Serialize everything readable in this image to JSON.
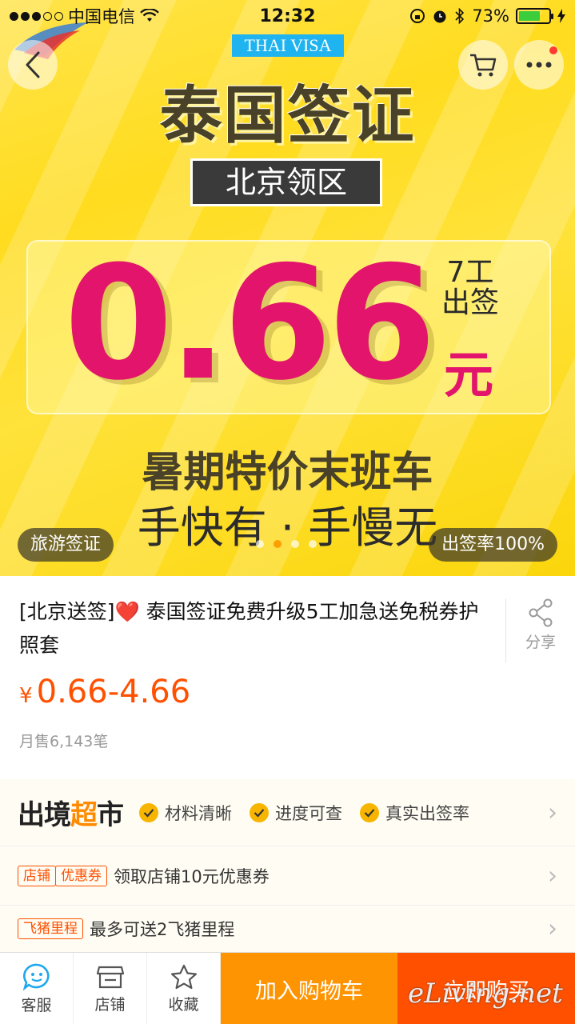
{
  "status_bar": {
    "carrier": "中国电信",
    "time": "12:32",
    "battery": "73%",
    "battery_level": 0.73
  },
  "hero": {
    "visa_tag": "THAI VISA",
    "title": "泰国签证",
    "region": "北京领区",
    "price": "0.66",
    "badge_line1": "7工",
    "badge_line2": "出签",
    "badge_unit": "元",
    "slogan_1": "暑期特价末班车",
    "slogan_2": "手快有 · 手慢无",
    "pill_left": "旅游签证",
    "pill_right": "出签率100%",
    "carousel_active_index": 1
  },
  "product": {
    "title_prefix": "[北京送签]",
    "title_heart": "❤️",
    "title_main": "泰国签证免费升级5工加急送免税券护照套",
    "share_label": "分享",
    "currency": "¥",
    "price_range": "0.66-4.66",
    "monthly_sales": "月售6,143笔"
  },
  "promo": {
    "brand_prefix": "出境",
    "brand_mid": "超",
    "brand_suffix": "市",
    "features": [
      "材料清晰",
      "进度可查",
      "真实出签率"
    ],
    "coupon_tags": [
      "店铺",
      "优惠券"
    ],
    "coupon_text": "领取店铺10元优惠券",
    "mileage_tag": "飞猪里程",
    "mileage_text": "最多可送2飞猪里程"
  },
  "bottom_bar": {
    "service": "客服",
    "store": "店铺",
    "favorite": "收藏",
    "add_to_cart": "加入购物车",
    "buy_now": "立即购买"
  },
  "watermark": "eLiving.net",
  "colors": {
    "accent": "#ff5000",
    "cart_button": "#ff9402",
    "price_pink": "#e3146b",
    "banner_yellow": "#ffdc1f"
  },
  "icons": [
    "back-icon",
    "cart-icon",
    "more-icon",
    "wifi-icon",
    "alarm-icon",
    "bluetooth-icon",
    "share-icon",
    "check-icon",
    "chevron-right-icon",
    "service-icon",
    "store-icon",
    "star-icon"
  ]
}
